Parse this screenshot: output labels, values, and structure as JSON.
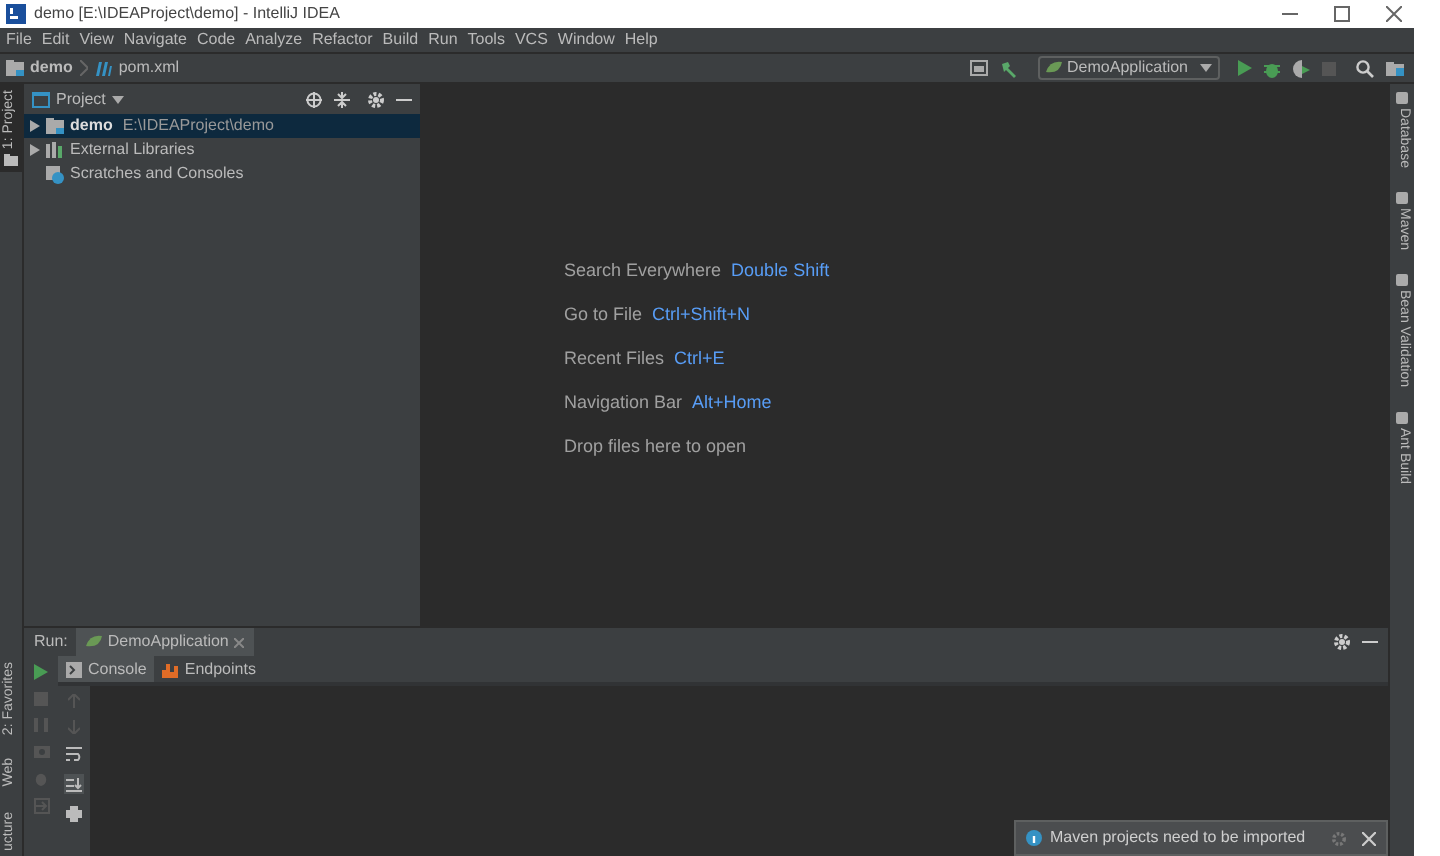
{
  "window": {
    "title": "demo [E:\\IDEAProject\\demo] - IntelliJ IDEA"
  },
  "menu": [
    "File",
    "Edit",
    "View",
    "Navigate",
    "Code",
    "Analyze",
    "Refactor",
    "Build",
    "Run",
    "Tools",
    "VCS",
    "Window",
    "Help"
  ],
  "breadcrumb": [
    {
      "label": "demo",
      "kind": "folder"
    },
    {
      "label": "pom.xml",
      "kind": "maven"
    }
  ],
  "toolbar": {
    "run_config": "DemoApplication"
  },
  "left_strip": [
    {
      "label": "1: Project",
      "selected": true,
      "kind": "top"
    },
    {
      "label": "2: Favorites",
      "selected": false,
      "kind": "bottom"
    },
    {
      "label": "Web",
      "selected": false,
      "kind": "bottom"
    },
    {
      "label": "ucture",
      "selected": false,
      "kind": "bottom"
    }
  ],
  "right_strip": [
    {
      "label": "Database"
    },
    {
      "label": "Maven"
    },
    {
      "label": "Bean Validation"
    },
    {
      "label": "Ant Build"
    }
  ],
  "project": {
    "title": "Project",
    "tree": [
      {
        "kind": "module",
        "label": "demo",
        "path": "E:\\IDEAProject\\demo",
        "selected": true
      },
      {
        "kind": "library",
        "label": "External Libraries",
        "selected": false
      },
      {
        "kind": "scratches",
        "label": "Scratches and Consoles",
        "selected": false
      }
    ]
  },
  "editor_hints": [
    {
      "label": "Search Everywhere",
      "shortcut": "Double Shift"
    },
    {
      "label": "Go to File",
      "shortcut": "Ctrl+Shift+N"
    },
    {
      "label": "Recent Files",
      "shortcut": "Ctrl+E"
    },
    {
      "label": "Navigation Bar",
      "shortcut": "Alt+Home"
    },
    {
      "label": "Drop files here to open"
    }
  ],
  "run": {
    "label": "Run:",
    "tabs": [
      {
        "label": "DemoApplication",
        "selected": true
      }
    ],
    "subtabs": [
      {
        "label": "Console",
        "selected": true,
        "kind": "console"
      },
      {
        "label": "Endpoints",
        "selected": false,
        "kind": "endpoints"
      }
    ]
  },
  "notification": {
    "text": "Maven projects need to be imported"
  }
}
